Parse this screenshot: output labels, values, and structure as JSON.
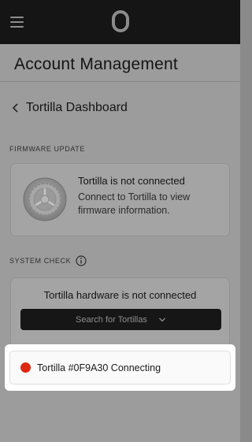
{
  "header": {
    "menu_icon": "hamburger-menu-icon",
    "logo_icon": "brand-zero-logo"
  },
  "page": {
    "title": "Account Management",
    "breadcrumb_label": "Tortilla Dashboard",
    "breadcrumb_icon": "chevron-left-icon"
  },
  "firmware": {
    "section_label": "FIRMWARE UPDATE",
    "title": "Tortilla is not connected",
    "description": "Connect to Tortilla to view firmware information.",
    "icon": "gear-icon"
  },
  "system_check": {
    "section_label": "SYSTEM CHECK",
    "info_icon": "info-icon",
    "title": "Tortilla hardware is not connected",
    "search_button_label": "Search for Tortillas",
    "search_button_icon": "chevron-down-icon"
  },
  "device": {
    "label": "Tortilla #0F9A30 Connecting",
    "status_color": "#dd2712"
  },
  "colors": {
    "topbar": "#151515",
    "overlay_content": "#9c9c9c",
    "highlight": "#ffffff"
  }
}
